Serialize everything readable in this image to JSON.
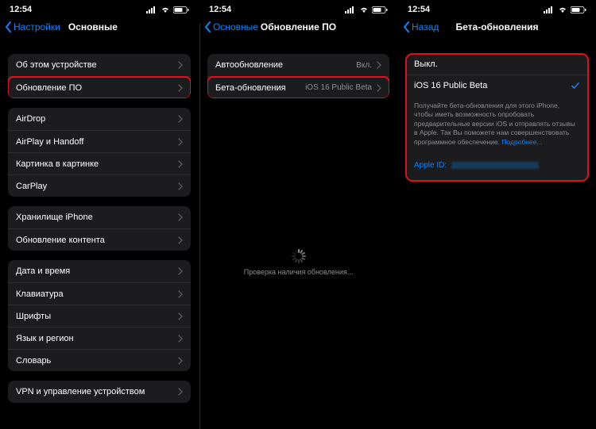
{
  "status": {
    "time": "12:54"
  },
  "phone1": {
    "back": "Настройки",
    "title": "Основные",
    "g1": [
      {
        "label": "Об этом устройстве"
      },
      {
        "label": "Обновление ПО",
        "highlight": true
      }
    ],
    "g2": [
      {
        "label": "AirDrop"
      },
      {
        "label": "AirPlay и Handoff"
      },
      {
        "label": "Картинка в картинке"
      },
      {
        "label": "CarPlay"
      }
    ],
    "g3": [
      {
        "label": "Хранилище iPhone"
      },
      {
        "label": "Обновление контента"
      }
    ],
    "g4": [
      {
        "label": "Дата и время"
      },
      {
        "label": "Клавиатура"
      },
      {
        "label": "Шрифты"
      },
      {
        "label": "Язык и регион"
      },
      {
        "label": "Словарь"
      }
    ],
    "g5": [
      {
        "label": "VPN и управление устройством"
      }
    ]
  },
  "phone2": {
    "back": "Основные",
    "title": "Обновление ПО",
    "rows": [
      {
        "label": "Автообновление",
        "value": "Вкл."
      },
      {
        "label": "Бета-обновления",
        "value": "iOS 16 Public Beta",
        "highlight": true
      }
    ],
    "checking": "Проверка наличия обновления..."
  },
  "phone3": {
    "back": "Назад",
    "title": "Бета-обновления",
    "options": [
      {
        "label": "Выкл.",
        "checked": false
      },
      {
        "label": "iOS 16 Public Beta",
        "checked": true
      }
    ],
    "footer": "Получайте бета-обновления для этого iPhone, чтобы иметь возможность опробовать предварительные версии iOS и отправлять отзывы в Apple. Так Вы поможете нам совершенствовать программное обеспечение.",
    "footer_link": "Подробнее...",
    "appleid_label": "Apple ID:"
  }
}
